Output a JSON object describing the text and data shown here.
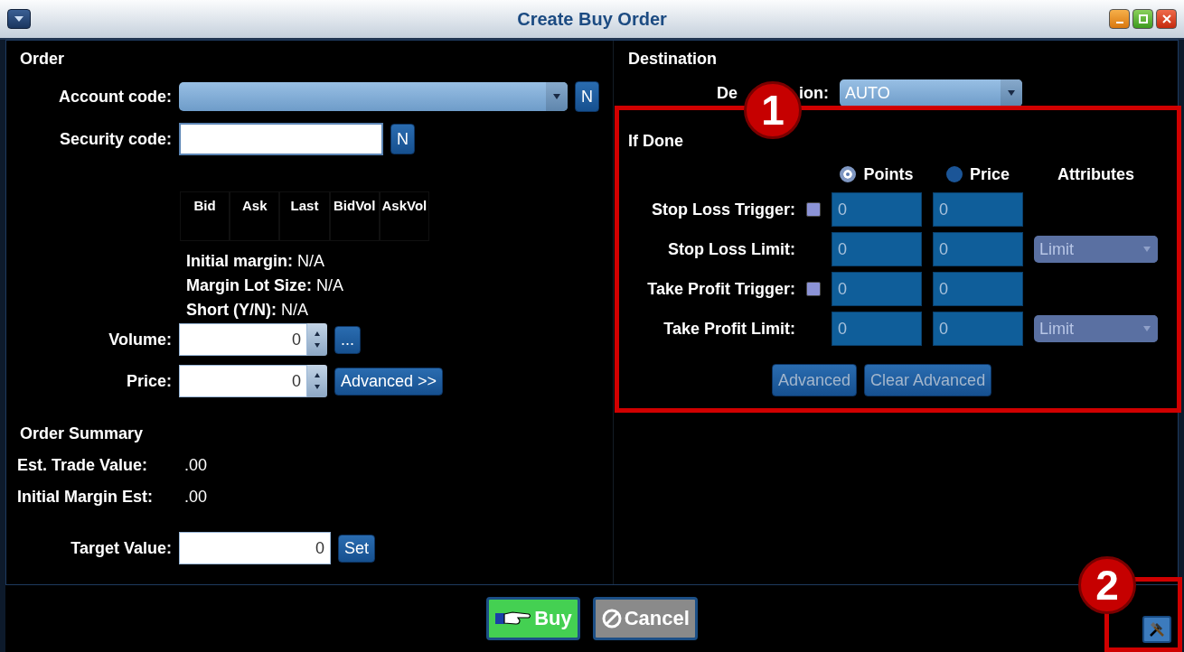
{
  "window": {
    "title": "Create Buy Order"
  },
  "order": {
    "heading": "Order",
    "account_code": {
      "label": "Account code:",
      "button": "N"
    },
    "security_code": {
      "label": "Security code:",
      "button": "N"
    },
    "quote_columns": [
      "Bid",
      "Ask",
      "Last",
      "BidVol",
      "AskVol"
    ],
    "info": [
      {
        "label": "Initial margin:",
        "value": "N/A"
      },
      {
        "label": "Margin Lot Size:",
        "value": "N/A"
      },
      {
        "label": "Short (Y/N):",
        "value": "N/A"
      }
    ],
    "volume": {
      "label": "Volume:",
      "value": "0",
      "button": "..."
    },
    "price": {
      "label": "Price:",
      "value": "0",
      "button": "Advanced >>"
    }
  },
  "order_summary": {
    "heading": "Order Summary",
    "items": [
      {
        "label": "Est. Trade Value:",
        "value": ".00"
      },
      {
        "label": "Initial Margin Est:",
        "value": ".00"
      }
    ],
    "target": {
      "label": "Target Value:",
      "value": "0",
      "button": "Set"
    }
  },
  "destination": {
    "heading": "Destination",
    "label_parts": [
      "De",
      "ion:"
    ],
    "value": "AUTO"
  },
  "if_done": {
    "heading": "If Done",
    "modes": [
      {
        "label": "Points",
        "selected": true
      },
      {
        "label": "Price",
        "selected": false
      }
    ],
    "attributes_heading": "Attributes",
    "rows": [
      {
        "label": "Stop Loss Trigger:",
        "kind": "trigger",
        "checked": false,
        "points": "0",
        "price": "0"
      },
      {
        "label": "Stop Loss Limit:",
        "kind": "limit",
        "points": "0",
        "price": "0",
        "attribute": "Limit",
        "disabled": true
      },
      {
        "label": "Take Profit Trigger:",
        "kind": "trigger",
        "checked": false,
        "points": "0",
        "price": "0"
      },
      {
        "label": "Take Profit Limit:",
        "kind": "limit",
        "points": "0",
        "price": "0",
        "attribute": "Limit",
        "disabled": true
      }
    ],
    "buttons": [
      {
        "label": "Advanced",
        "disabled": true
      },
      {
        "label": "Clear Advanced",
        "disabled": true
      }
    ]
  },
  "footer": {
    "buttons": [
      {
        "label": "Buy",
        "kind": "buy"
      },
      {
        "label": "Cancel",
        "kind": "cancel"
      }
    ]
  },
  "annotations": [
    {
      "number": "1"
    },
    {
      "number": "2"
    }
  ]
}
